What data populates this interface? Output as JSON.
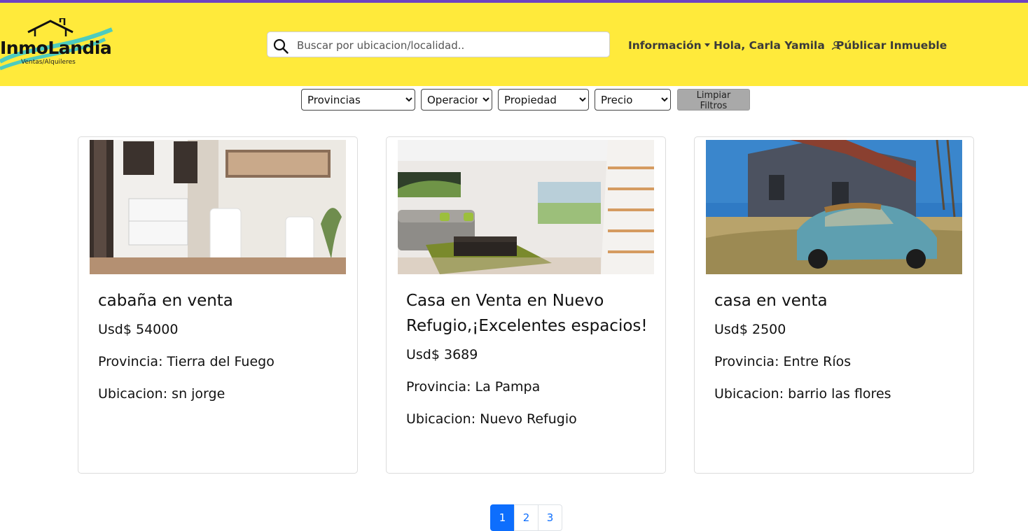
{
  "header": {
    "logo_text": "InmoLandia",
    "logo_sub": "Ventas/Alquileres",
    "accent_color": "#ffea3b",
    "top_line_color": "#6f42c1"
  },
  "search": {
    "placeholder": "Buscar por ubicacion/localidad.."
  },
  "nav": {
    "info_label": "Información",
    "user_label": "Hola, Carla Yamila",
    "publish_label": "Públicar Inmueble"
  },
  "filters": {
    "provincias": "Provincias",
    "operacion": "Operacion",
    "propiedad": "Propiedad",
    "precio": "Precio",
    "clear_label": "Limpiar Filtros"
  },
  "cards": [
    {
      "title": "cabaña en venta",
      "price": "Usd$ 54000",
      "province": "Provincia: Tierra del Fuego",
      "location": "Ubicacion: sn jorge",
      "image": "bathroom-photo"
    },
    {
      "title": "Casa en Venta en Nuevo Refugio,¡Excelentes espacios!",
      "price": "Usd$ 3689",
      "province": "Provincia: La Pampa",
      "location": "Ubicacion: Nuevo Refugio",
      "image": "living-room-photo"
    },
    {
      "title": "casa en venta",
      "price": "Usd$ 2500",
      "province": "Provincia: Entre Ríos",
      "location": "Ubicacion: barrio las flores",
      "image": "abandoned-house-photo"
    }
  ],
  "pagination": {
    "pages": [
      "1",
      "2",
      "3"
    ],
    "active": "1",
    "active_color": "#0d6efd"
  }
}
